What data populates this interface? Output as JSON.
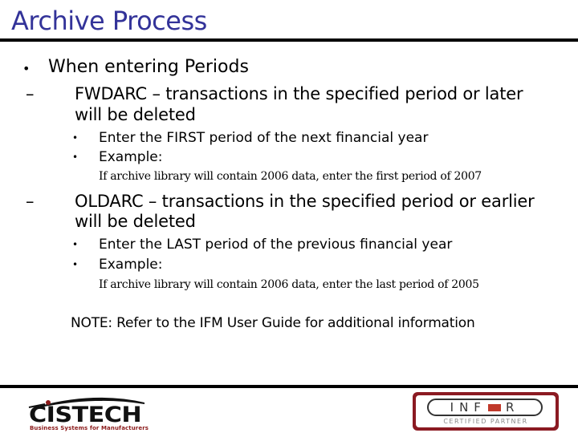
{
  "slide": {
    "title": "Archive Process",
    "bullets": [
      {
        "marker": "•",
        "text": "When entering Periods",
        "children": [
          {
            "marker": "–",
            "line1": "FWDARC – transactions in the specified period or later",
            "line2": "will be deleted",
            "children": [
              {
                "marker": "•",
                "text": "Enter the FIRST period of the next financial year"
              },
              {
                "marker": "•",
                "text": "Example:"
              }
            ],
            "example": "If archive library will contain 2006 data, enter the first period of 2007"
          },
          {
            "marker": "–",
            "line1": "OLDARC – transactions in the specified period or earlier",
            "line2": "will be deleted",
            "children": [
              {
                "marker": "•",
                "text": "Enter the LAST period of the previous financial year"
              },
              {
                "marker": "•",
                "text": "Example:"
              }
            ],
            "example": "If archive library will contain 2006 data, enter the last period of 2005"
          }
        ]
      }
    ],
    "note": "NOTE:  Refer to the IFM User Guide for additional information"
  },
  "footer": {
    "left_logo": {
      "name": "CISTECH",
      "tagline": "Business Systems for Manufacturers"
    },
    "right_logo": {
      "name": "INFOR",
      "letters": [
        "I",
        "N",
        "F",
        "",
        "R"
      ],
      "subtitle": "CERTIFIED PARTNER"
    }
  },
  "colors": {
    "title": "#333399",
    "rule": "#000000",
    "cistech_accent": "#8b1a1a",
    "infor_frame": "#8b1a22",
    "infor_o": "#c0392b"
  }
}
